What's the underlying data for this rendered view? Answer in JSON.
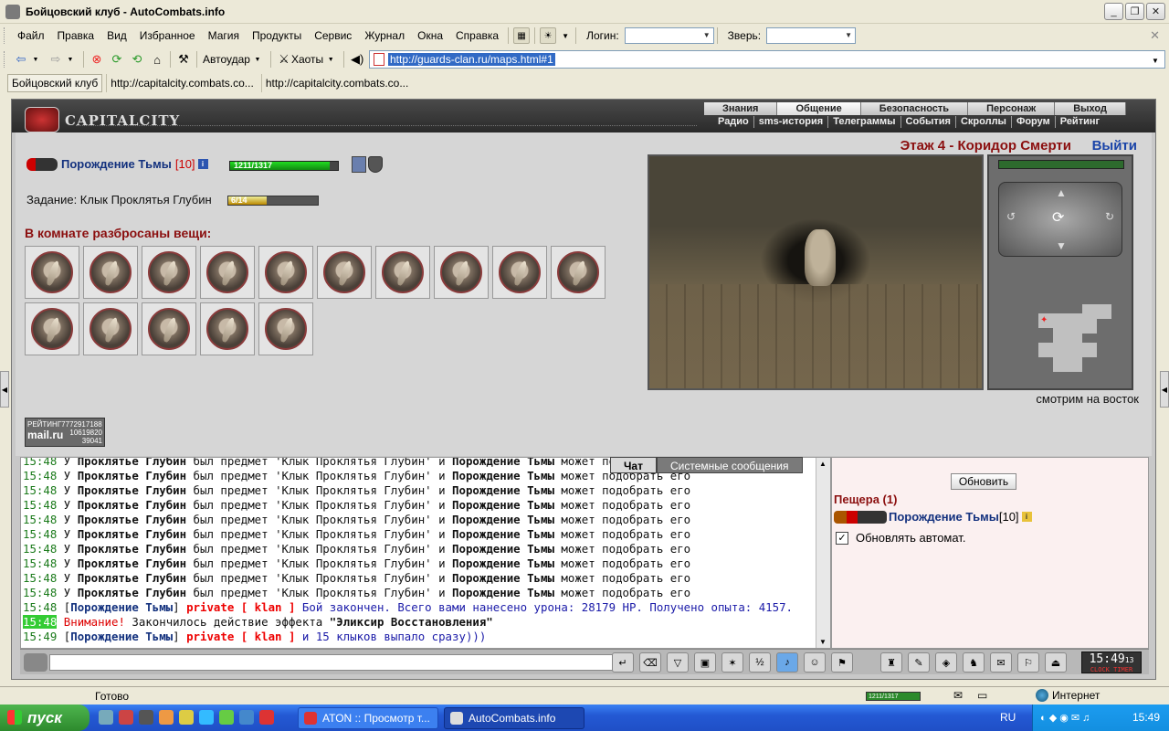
{
  "window": {
    "title": "Бойцовский клуб - AutoCombats.info",
    "controls": [
      "_",
      "❐",
      "✕"
    ]
  },
  "menu": {
    "items": [
      "Файл",
      "Правка",
      "Вид",
      "Избранное",
      "Магия",
      "Продукты",
      "Сервис",
      "Журнал",
      "Окна",
      "Справка"
    ],
    "login_label": "Логин:",
    "beast_label": "Зверь:"
  },
  "toolbar": {
    "autohit_label": "Автоудар",
    "chaos_label": "Хаоты",
    "address": "http://guards-clan.ru/maps.html#1"
  },
  "links": [
    "Бойцовский клуб",
    "http://capitalcity.combats.co...",
    "http://capitalcity.combats.co..."
  ],
  "game": {
    "logo_text": "CAPITALCITY",
    "nav_top": [
      "Знания",
      "Общение",
      "Безопасность",
      "Персонаж",
      "Выход"
    ],
    "nav_active": "Общение",
    "nav_bottom": [
      "Радио",
      "sms-история",
      "Телеграммы",
      "События",
      "Скроллы",
      "Форум",
      "Рейтинг"
    ],
    "player": {
      "name": "Порождение Тьмы",
      "level": "[10]",
      "hp_text": "1211/1317",
      "hp_fraction": 0.92
    },
    "quest": {
      "label": "Задание: Клык Проклятья Глубин",
      "progress_text": "6/14",
      "progress_fraction": 0.43
    },
    "items_title": "В комнате разбросаны вещи:",
    "item_count": 15,
    "floor_title": "Этаж 4 - Коридор Смерти",
    "exit_label": "Выйти",
    "facing": "смотрим на восток",
    "rating": {
      "label": "РЕЙТИНГ",
      "id": "7772917188",
      "line2": "10619820",
      "line3": "39041",
      "brand": "mail.ru"
    }
  },
  "chat": {
    "tabs": [
      "Чат",
      "Системные сообщения"
    ],
    "loot_lines": {
      "time": "15:48",
      "prefix": "У",
      "owner": "Проклятье Глубин",
      "mid": "был предмет 'Клык Проклятья Глубин' и",
      "picker": "Порождение Тьмы",
      "suffix": "может подобрать его",
      "count": 10
    },
    "line_battle": {
      "time": "15:48",
      "name": "Порождение Тьмы",
      "private": "private [ klan ]",
      "text": "Бой закончен. Всего вами нанесено урона: 28179 HP. Получено опыта: 4157."
    },
    "line_warn": {
      "time": "15:48",
      "warn": "Внимание!",
      "text": "Закончилось действие эффекта",
      "effect": "\"Эликсир Восстановления\""
    },
    "line_last": {
      "time": "15:49",
      "name": "Порождение Тьмы",
      "private": "private [ klan ]",
      "text": "и 15 клыков выпало сразу)))"
    }
  },
  "room": {
    "refresh_label": "Обновить",
    "title": "Пещера (1)",
    "player_name": "Порождение Тьмы",
    "player_level": "[10]",
    "auto_refresh_label": "Обновлять автомат.",
    "auto_refresh_checked": true
  },
  "clock": {
    "time": "15:49",
    "seconds": "13",
    "sub": "CLOCK TIMER"
  },
  "status": {
    "text": "Готово",
    "hp_text": "1211/1317",
    "zone": "Интернет"
  },
  "taskbar": {
    "start": "пуск",
    "tasks": [
      "ATON :: Просмотр т...",
      "AutoCombats.info"
    ],
    "lang": "RU",
    "time": "15:49"
  }
}
